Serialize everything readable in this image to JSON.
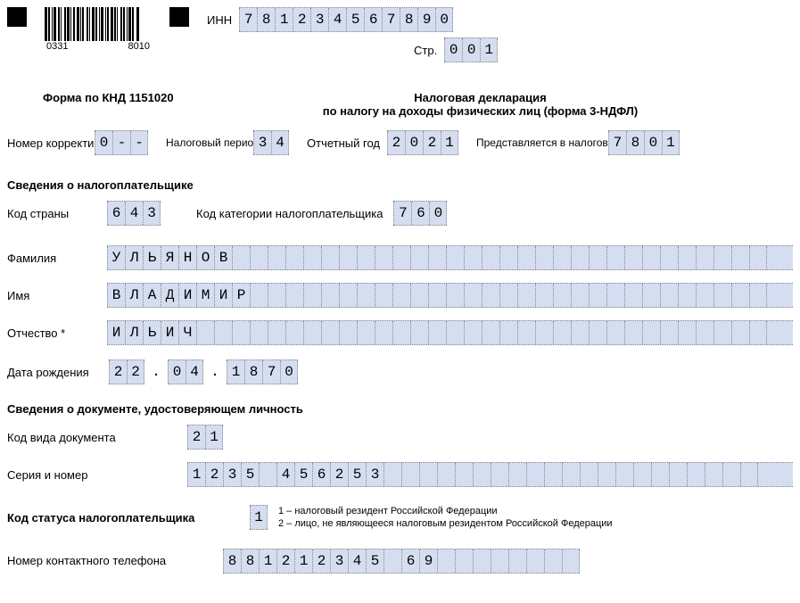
{
  "barcode": {
    "left": "0331",
    "right": "8010"
  },
  "inn": {
    "label": "ИНН",
    "value": "781234567890"
  },
  "page": {
    "label": "Стр.",
    "value": "001"
  },
  "form_code": "Форма по КНД 1151020",
  "title1": "Налоговая декларация",
  "title2": "по налогу на доходы физических лиц (форма 3-НДФЛ)",
  "correction": {
    "label": "Номер корректировки",
    "value": "0--"
  },
  "tax_period": {
    "label": "Налоговый период (код)",
    "value": "34"
  },
  "report_year": {
    "label": "Отчетный год",
    "value": "2021"
  },
  "tax_authority": {
    "label": "Представляется в налоговый орган (код)",
    "value": "7801"
  },
  "section_taxpayer": "Сведения о налогоплательщике",
  "country_code": {
    "label": "Код страны",
    "value": "643"
  },
  "taxpayer_category": {
    "label": "Код категории налогоплательщика",
    "value": "760"
  },
  "surname": {
    "label": "Фамилия",
    "value": "УЛЬЯНОВ"
  },
  "name": {
    "label": "Имя",
    "value": "ВЛАДИМИР"
  },
  "patronymic": {
    "label": "Отчество *",
    "value": "ИЛЬИЧ"
  },
  "dob": {
    "label": "Дата рождения",
    "day": "22",
    "month": "04",
    "year": "1870"
  },
  "section_document": "Сведения о документе, удостоверяющем личность",
  "doc_type": {
    "label": "Код вида документа",
    "value": "21"
  },
  "doc_number": {
    "label": "Серия и номер",
    "value": "1235 456253"
  },
  "taxpayer_status": {
    "label": "Код статуса налогоплательщика",
    "value": "1",
    "note1": "1 – налоговый резидент Российской Федерации",
    "note2": "2 – лицо, не являющееся налоговым резидентом Российской Федерации"
  },
  "phone": {
    "label": "Номер контактного телефона",
    "value": "881212345 69"
  }
}
